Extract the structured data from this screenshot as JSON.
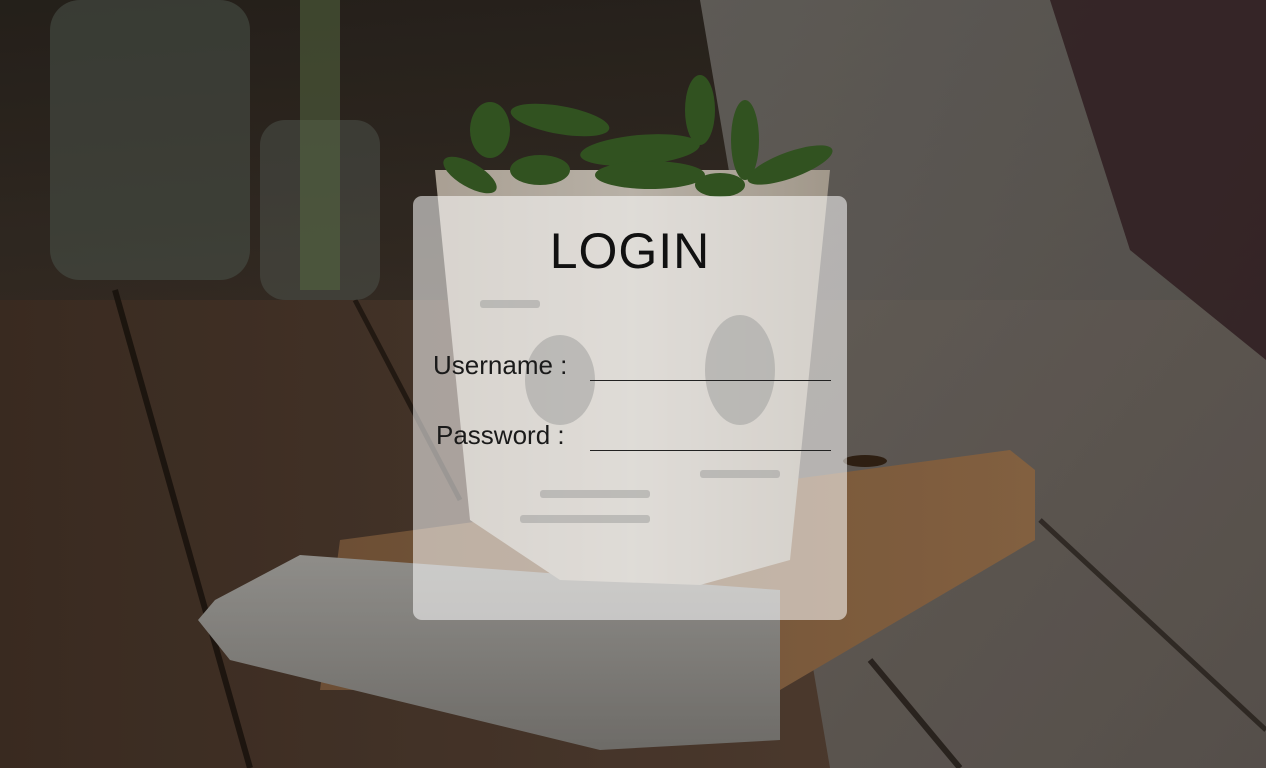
{
  "login": {
    "title": "LOGIN",
    "username_label": "Username :",
    "username_value": "",
    "password_label": "Password :",
    "password_value": ""
  },
  "background": {
    "description_icon": "edamame-cup-photo"
  }
}
